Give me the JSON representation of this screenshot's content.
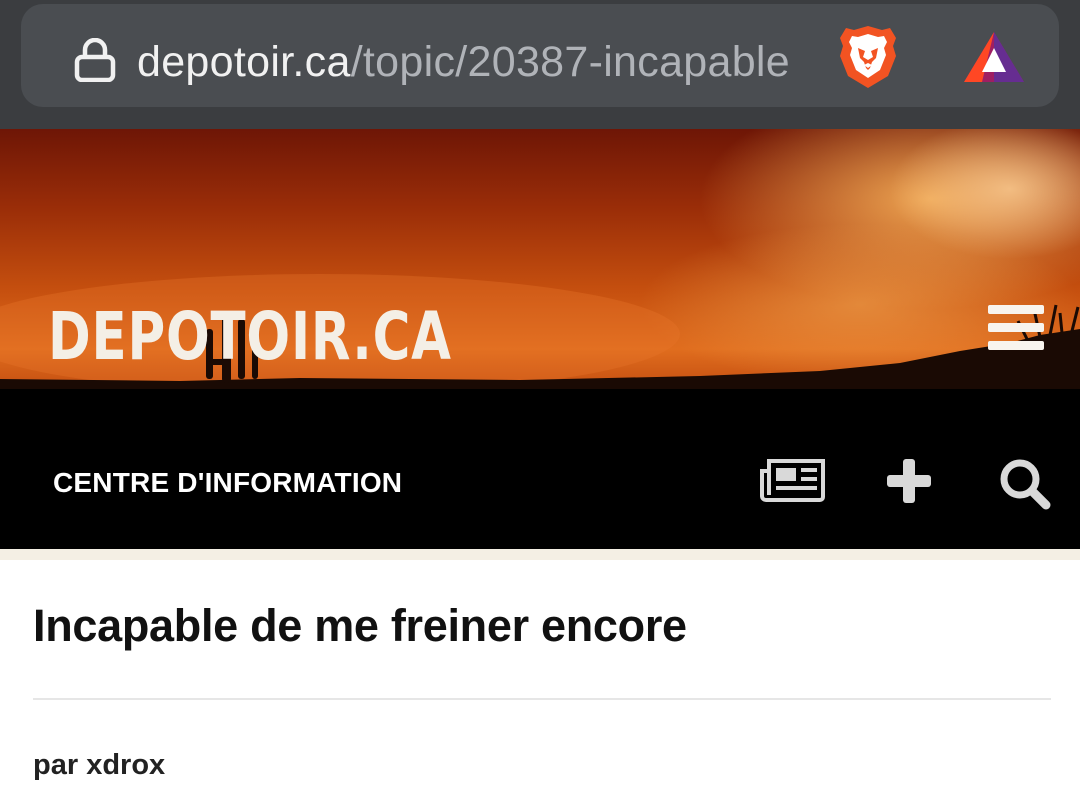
{
  "browser": {
    "url_domain": "depotoir.ca",
    "url_path": "/topic/20387-incapable",
    "accent": "#f1f1f1"
  },
  "header": {
    "logo": "DEPOTOIR.CA"
  },
  "nav": {
    "title": "CENTRE D'INFORMATION",
    "icons": [
      "news-icon",
      "plus-icon",
      "search-icon"
    ]
  },
  "topic": {
    "title": "Incapable de me freiner encore",
    "author_prefix": "par",
    "author": "xdrox"
  }
}
